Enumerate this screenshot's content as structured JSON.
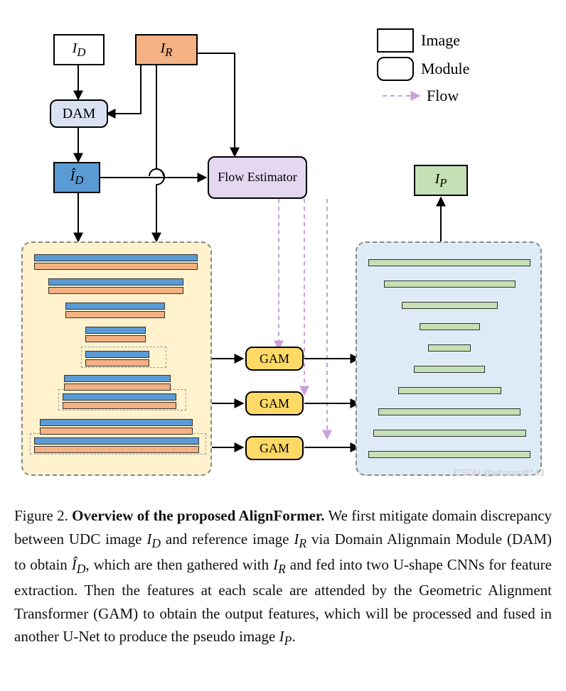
{
  "legend": {
    "image": "Image",
    "module": "Module",
    "flow": "Flow"
  },
  "nodes": {
    "id_label": "I_D",
    "ir_label": "I_R",
    "dam_label": "DAM",
    "idhat_label": "Î_D",
    "flow_est": "Flow Estimator",
    "ip_label": "I_P",
    "gam1": "GAM",
    "gam2": "GAM",
    "gam3": "GAM"
  },
  "caption": {
    "fig_label": "Figure 2.",
    "title": "Overview of the proposed AlignFormer.",
    "body": " We first mitigate domain discrepancy between UDC image I_D and reference image I_R via Domain Alignmain Module (DAM) to obtain Î_D, which are then gathered with I_R and fed into two U-shape CNNs for feature extraction. Then the features at each scale are attended by the Geometric Alignment Transformer (GAM) to obtain the output features, which will be processed and fused in another U-Net to produce the pseudo image I_P."
  },
  "watermark": "CSDN @whaosoft143",
  "colors": {
    "orange_fill": "#f4b183",
    "blue_light": "#d9e1f2",
    "blue_mid": "#5b9bd5",
    "purple": "#e4d7f0",
    "yellow_group": "#fff2cc",
    "blue_group": "#deebf7",
    "green": "#c5e0b4",
    "gam": "#ffd966",
    "bar_blue": "#5b9bd5",
    "bar_orange": "#f4b183",
    "bar_green": "#c5e0b4",
    "flow_arrow": "#c9a0dc"
  }
}
